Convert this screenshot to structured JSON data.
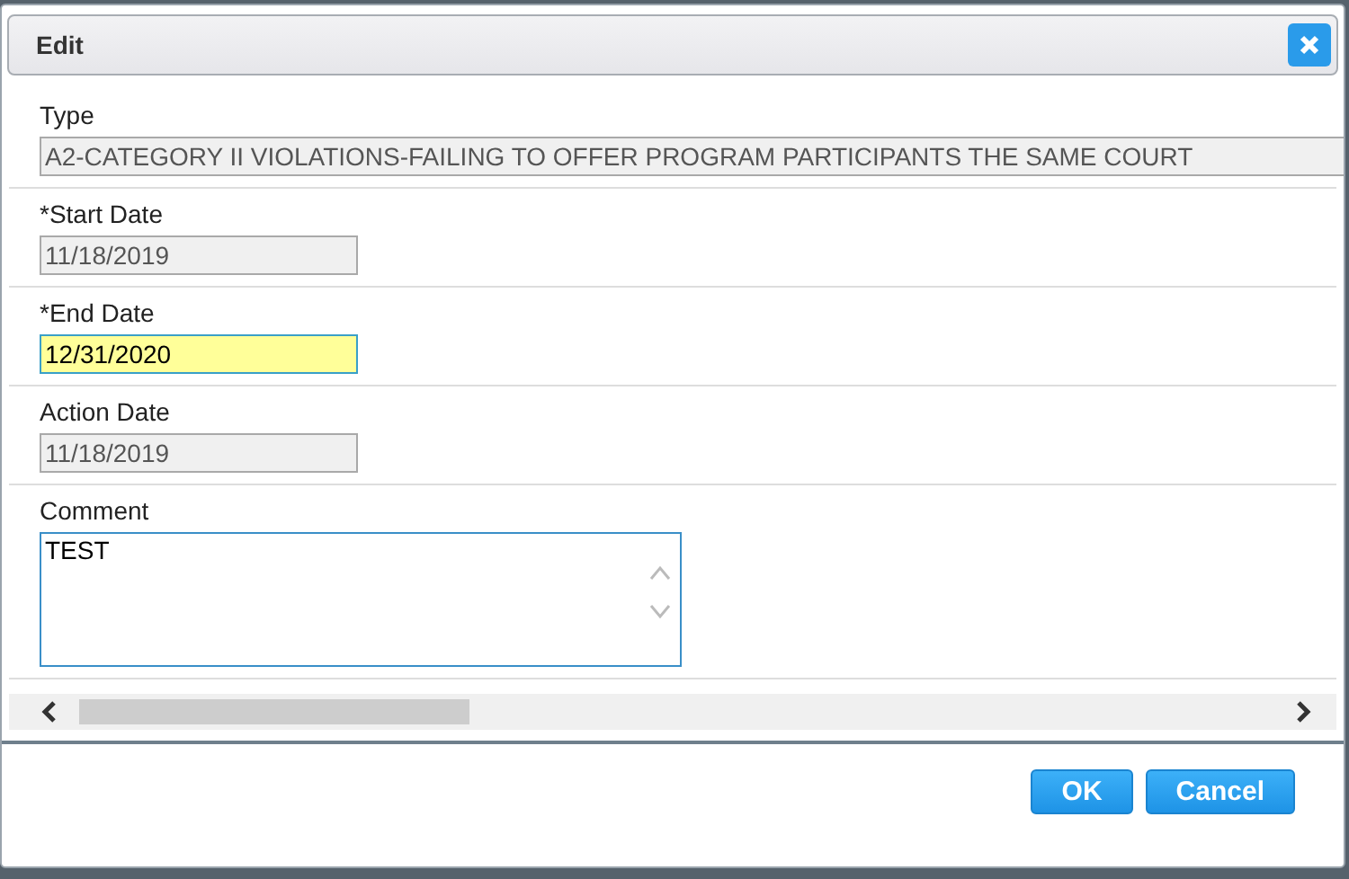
{
  "dialog": {
    "title": "Edit"
  },
  "fields": [
    {
      "kind": "text",
      "label": "Type",
      "value": "A2-CATEGORY II VIOLATIONS-FAILING TO OFFER PROGRAM PARTICIPANTS THE SAME COURT",
      "disabled": true,
      "highlighted": false
    },
    {
      "kind": "date",
      "label": "*Start Date",
      "value": "11/18/2019",
      "disabled": true,
      "highlighted": false
    },
    {
      "kind": "date",
      "label": "*End Date",
      "value": "12/31/2020",
      "disabled": false,
      "highlighted": true
    },
    {
      "kind": "date",
      "label": "Action Date",
      "value": "11/18/2019",
      "disabled": true,
      "highlighted": false
    },
    {
      "kind": "textarea",
      "label": "Comment",
      "value": "TEST",
      "disabled": false,
      "highlighted": false
    }
  ],
  "buttons": [
    "OK",
    "Cancel"
  ]
}
